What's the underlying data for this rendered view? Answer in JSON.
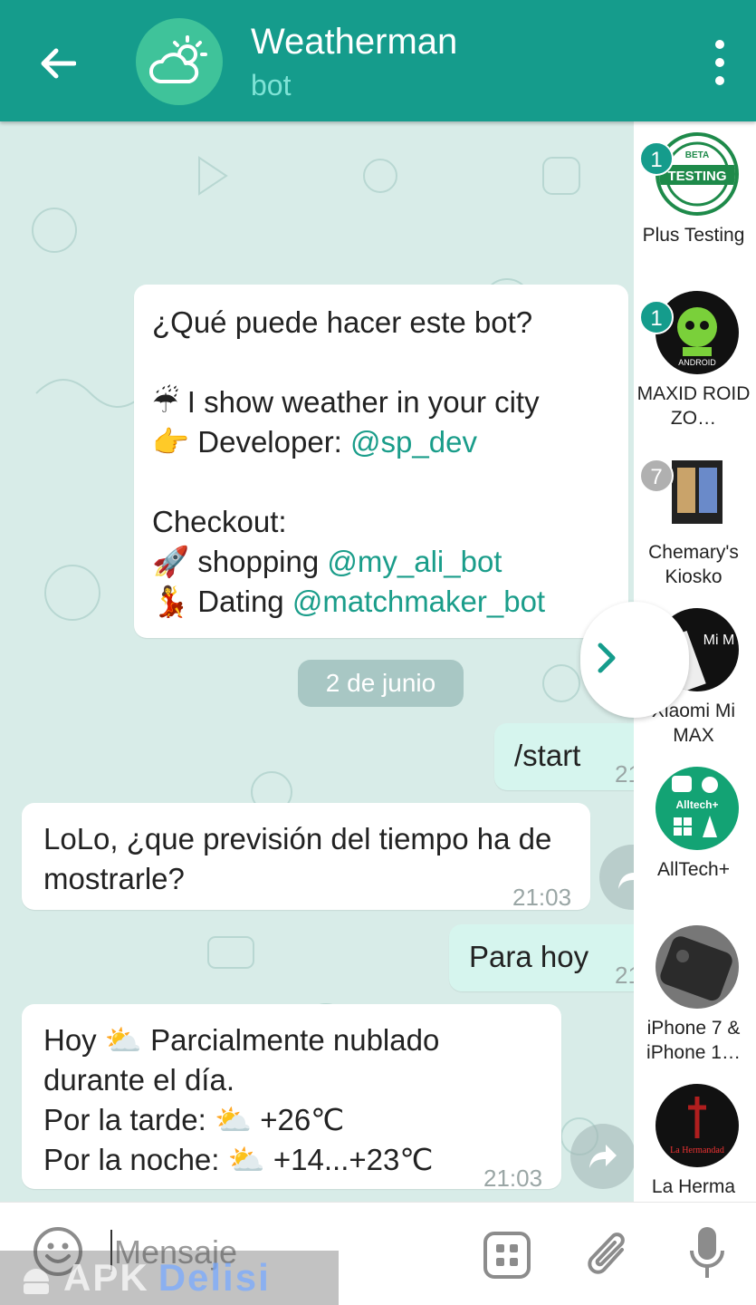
{
  "header": {
    "title": "Weatherman",
    "subtitle": "bot"
  },
  "messages": {
    "intro": {
      "heading": "¿Qué puede hacer este bot?",
      "line1_emoji": "☔",
      "line1_text": "I show weather in your city",
      "line2_emoji": "👉",
      "line2_text": "Developer: ",
      "line2_link": "@sp_dev",
      "checkout": "Checkout:",
      "line3_emoji": "🚀",
      "line3_text": "shopping ",
      "line3_link": "@my_ali_bot",
      "line4_emoji": "💃",
      "line4_text": "Dating ",
      "line4_link": "@matchmaker_bot"
    },
    "date_divider": "2 de junio",
    "start": {
      "text": "/start",
      "time": "21"
    },
    "q": {
      "text": "LoLo, ¿que previsión del tiempo ha de mostrarle?",
      "time": "21:03"
    },
    "today": {
      "text": "Para hoy",
      "time": "21"
    },
    "forecast": {
      "line1_a": "Hoy ",
      "emoji": "⛅",
      "line1_b": " Parcialmente nublado",
      "line2": "durante el día.",
      "line3_a": "Por la tarde: ",
      "line3_b": " +26℃",
      "line4_a": "Por la noche: ",
      "line4_b": " +14...+23℃",
      "time": "21:03"
    }
  },
  "side_panel": [
    {
      "name": "Plus Testing",
      "badge": "1",
      "badge_color": "#159c8c"
    },
    {
      "name": "MAXID ROID ZO…",
      "badge": "1",
      "badge_color": "#159c8c"
    },
    {
      "name": "Chemary's Kiosko",
      "badge": "7",
      "badge_color": "#b0b0b0"
    },
    {
      "name": "Xiaomi Mi MAX",
      "badge": "",
      "badge_color": ""
    },
    {
      "name": "AllTech+",
      "badge": "",
      "badge_color": ""
    },
    {
      "name": "iPhone 7 & iPhone 1…",
      "badge": "",
      "badge_color": ""
    },
    {
      "name": "La Herma",
      "badge": "",
      "badge_color": ""
    }
  ],
  "side_avatar_text": {
    "testing": "TESTING",
    "beta": "BETA",
    "android": "ANDROID",
    "alltech": "Alltech+",
    "xiaomi": "Mi M",
    "hermandad": "La Hermandad"
  },
  "input": {
    "placeholder": "Mensaje"
  },
  "watermark": {
    "apk": "APK",
    "delisi": "Delisi"
  },
  "colors": {
    "accent": "#159c8c",
    "link": "#1a9d8a",
    "outgoing": "#d6f5ee"
  }
}
